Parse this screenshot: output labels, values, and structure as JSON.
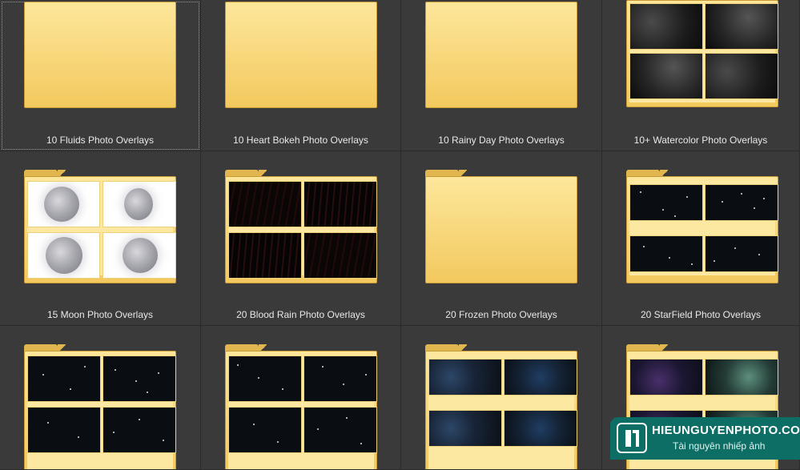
{
  "folders": [
    {
      "label": "10 Fluids Photo Overlays"
    },
    {
      "label": "10 Heart Bokeh Photo Overlays"
    },
    {
      "label": "10 Rainy Day Photo Overlays"
    },
    {
      "label": "10+ Watercolor Photo Overlays"
    },
    {
      "label": "15 Moon Photo Overlays"
    },
    {
      "label": "20 Blood Rain Photo Overlays"
    },
    {
      "label": "20 Frozen Photo Overlays"
    },
    {
      "label": "20 StarField Photo Overlays"
    },
    {
      "label": ""
    },
    {
      "label": ""
    },
    {
      "label": ""
    },
    {
      "label": ""
    }
  ],
  "watermark": {
    "brand": "HIEUNGUYENPHOTO.COM",
    "tagline": "Tài nguyên nhiếp ảnh"
  },
  "colors": {
    "background": "#2b2b2b",
    "tile": "#3a3a3a",
    "folder": "#f3c95e",
    "watermark": "#0d6e66"
  }
}
